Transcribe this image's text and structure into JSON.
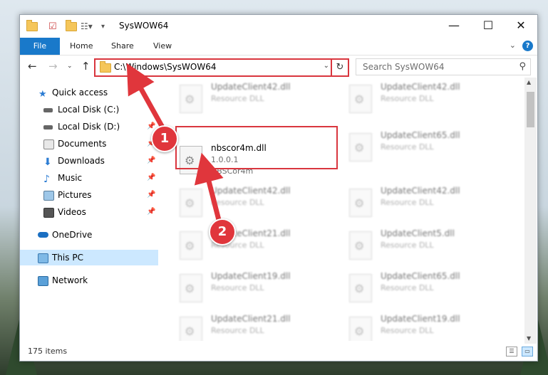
{
  "window": {
    "title": "SysWOW64",
    "controls": {
      "minimize": "—",
      "maximize": "☐",
      "close": "✕"
    }
  },
  "ribbon": {
    "tabs": [
      "File",
      "Home",
      "Share",
      "View"
    ],
    "help": "?"
  },
  "address": {
    "path": "C:\\Windows\\SysWOW64",
    "search_placeholder": "Search SysWOW64"
  },
  "sidebar": {
    "items": [
      {
        "label": "Quick access",
        "icon": "star-icon"
      },
      {
        "label": "Local Disk (C:)",
        "icon": "drive-icon"
      },
      {
        "label": "Local Disk (D:)",
        "icon": "drive-icon"
      },
      {
        "label": "Documents",
        "icon": "documents-icon"
      },
      {
        "label": "Downloads",
        "icon": "download-icon"
      },
      {
        "label": "Music",
        "icon": "music-icon"
      },
      {
        "label": "Pictures",
        "icon": "pictures-icon"
      },
      {
        "label": "Videos",
        "icon": "videos-icon"
      },
      {
        "label": "OneDrive",
        "icon": "cloud-icon"
      },
      {
        "label": "This PC",
        "icon": "computer-icon",
        "selected": true
      },
      {
        "label": "Network",
        "icon": "network-icon"
      }
    ]
  },
  "files": {
    "highlighted": {
      "name": "nbscor4m.dll",
      "version": "1.0.0.1",
      "description": "NBSCor4m"
    },
    "left_column": [
      {
        "name": "UpdateClient42.dll",
        "type": "Resource DLL"
      },
      {
        "name": "UpdateClient42.dll",
        "type": "Resource DLL"
      },
      {
        "name": "UpdateClient21.dll",
        "type": "Resource DLL"
      },
      {
        "name": "UpdateClient19.dll",
        "type": "Resource DLL"
      },
      {
        "name": "UpdateClient21.dll",
        "type": "Resource DLL"
      }
    ],
    "right_column": [
      {
        "name": "UpdateClient42.dll",
        "type": "Resource DLL"
      },
      {
        "name": "UpdateClient65.dll",
        "type": "Resource DLL"
      },
      {
        "name": "UpdateClient42.dll",
        "type": "Resource DLL"
      },
      {
        "name": "UpdateClient5.dll",
        "type": "Resource DLL"
      },
      {
        "name": "UpdateClient65.dll",
        "type": "Resource DLL"
      },
      {
        "name": "UpdateClient19.dll",
        "type": "Resource DLL"
      }
    ]
  },
  "status": {
    "item_count": "175 items"
  },
  "callouts": {
    "step1": "1",
    "step2": "2"
  },
  "colors": {
    "accent": "#1979ca",
    "highlight": "#d9363e",
    "selection": "#cce8ff"
  }
}
